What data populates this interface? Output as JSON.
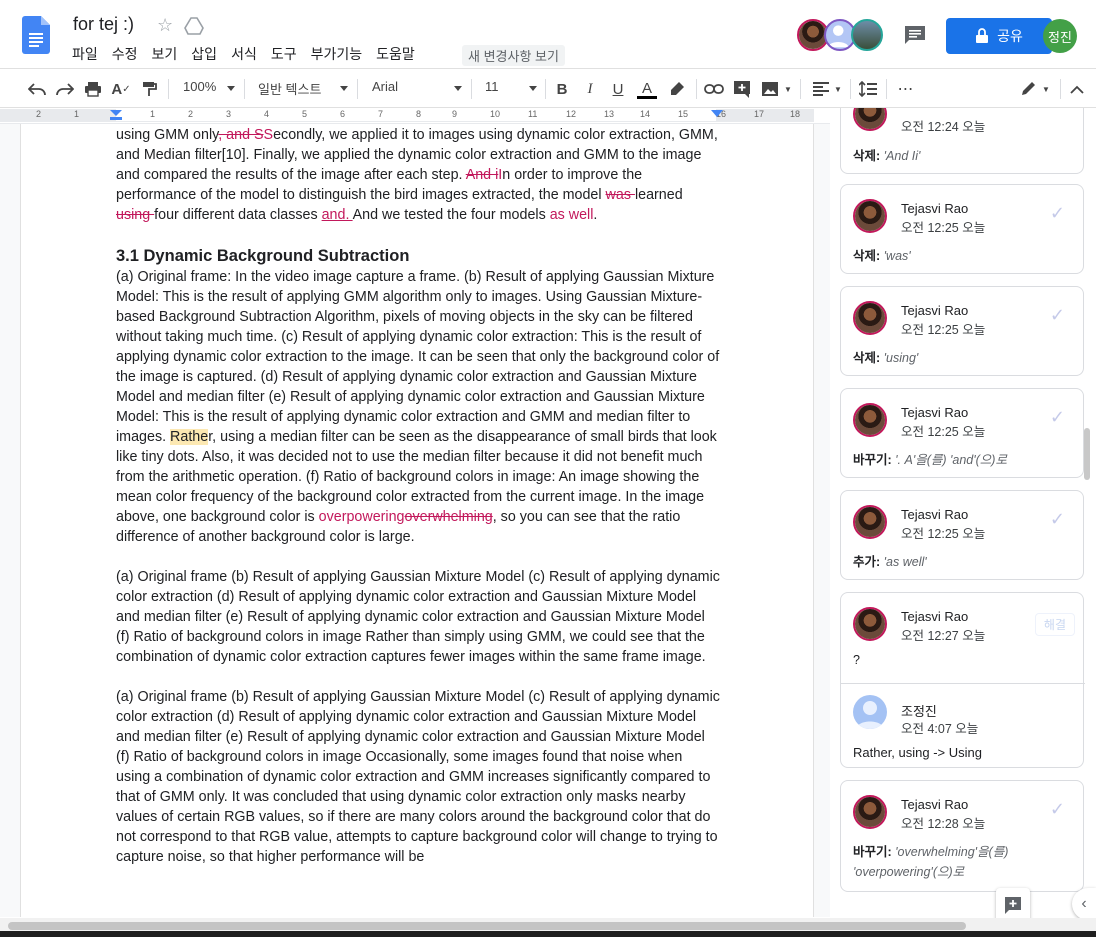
{
  "header": {
    "title": "for tej :)",
    "last_edit": "새 변경사항 보기",
    "share_label": "공유",
    "user_initials": "정진",
    "menu": [
      "파일",
      "수정",
      "보기",
      "삽입",
      "서식",
      "도구",
      "부가기능",
      "도움말"
    ]
  },
  "toolbar": {
    "zoom": "100%",
    "style": "일반 텍스트",
    "font": "Arial",
    "font_size": "11"
  },
  "ruler": {
    "numbers": [
      "2",
      "1",
      "1",
      "2",
      "3",
      "4",
      "5",
      "6",
      "7",
      "8",
      "9",
      "10",
      "11",
      "12",
      "13",
      "14",
      "15",
      "16",
      "17",
      "18"
    ]
  },
  "doc": {
    "p1_a": "using GMM only",
    "p1_del1": ", and S",
    "p1_ins1": "S",
    "p1_b": "econdly, we applied it to images using dynamic color extraction, GMM, and Median filter[10]. Finally, we applied the dynamic color extraction and GMM to the image and compared the results of the image after each step. ",
    "p1_del2": "And i",
    "p1_ins2": "I",
    "p1_c": "n order to improve the performance of the model to distinguish the bird images extracted, the model ",
    "p1_del3": "was ",
    "p1_d": "learned ",
    "p1_del4": "using ",
    "p1_e": "four different data classes ",
    "p1_ins3": "and. ",
    "p1_f": "And we tested the four models",
    "p1_ins4": " as well",
    "p1_g": ".",
    "h1": "3.1 Dynamic Background Subtraction",
    "p2_a": "(a) Original frame: In the video image capture a frame. (b) Result of applying Gaussian Mixture Model: This is the result of applying GMM algorithm only to images. Using Gaussian Mixture-based Background Subtraction Algorithm, pixels of moving objects in the sky can be filtered without taking much time. (c) Result of applying dynamic color extraction: This is the result of applying dynamic color extraction to the image. It can be seen that only the background color of the image is captured. (d) Result of applying dynamic color extraction and Gaussian Mixture Model and median filter (e) Result of applying dynamic color extraction and Gaussian Mixture Model: This is the result of applying dynamic color extraction and GMM and median filter to images. ",
    "p2_hl": "Rathe",
    "p2_b": "r, using a median filter can be seen as the disappearance of small birds that look like tiny dots. Also, it was decided not to use the median filter because it did not benefit much from the arithmetic operation. (f) Ratio of background colors in image: An image showing the mean color frequency of the background color extracted from the current image. In the image above, one background color is ",
    "p2_ins": "overpowering",
    "p2_del": "overwhelming",
    "p2_c": ", so you can see that the ratio difference of another background color is large.",
    "p3": "(a) Original frame (b) Result of applying Gaussian Mixture Model (c) Result of applying dynamic color extraction (d) Result of applying dynamic color extraction and Gaussian Mixture Model and median filter (e) Result of applying dynamic color extraction and Gaussian Mixture Model (f) Ratio of background colors in image Rather than simply using GMM, we could see that the combination of dynamic color extraction captures fewer images within the same frame image.",
    "p4": "(a) Original frame (b) Result of applying Gaussian Mixture Model (c) Result of applying dynamic color extraction (d) Result of applying dynamic color extraction and Gaussian Mixture Model and median filter (e) Result of applying dynamic color extraction and Gaussian Mixture Model (f) Ratio of background colors in image Occasionally, some images found that noise when using a combination of dynamic color extraction and GMM increases significantly compared to that of GMM only. It was concluded that using dynamic color extraction only masks nearby values of certain RGB values, so if there are many colors around the background color that do not correspond to that RGB value, attempts to capture background color will change to trying to capture noise, so that higher performance will be"
  },
  "comments": [
    {
      "time": "오전 12:24 오늘",
      "label": "삭제:",
      "value": "'And Ii'"
    },
    {
      "name": "Tejasvi Rao",
      "time": "오전 12:25 오늘",
      "label": "삭제:",
      "value": "'was'"
    },
    {
      "name": "Tejasvi Rao",
      "time": "오전 12:25 오늘",
      "label": "삭제:",
      "value": "'using'"
    },
    {
      "name": "Tejasvi Rao",
      "time": "오전 12:25 오늘",
      "label": "바꾸기:",
      "value": "'. A'을(를) 'and'(으)로"
    },
    {
      "name": "Tejasvi Rao",
      "time": "오전 12:25 오늘",
      "label": "추가:",
      "value": "'as well'"
    },
    {
      "name": "Tejasvi Rao",
      "time": "오전 12:27 오늘",
      "value": "?",
      "resolve": "해결",
      "reply": {
        "name": "조정진",
        "time": "오전 4:07 오늘",
        "value": "Rather, using -> Using"
      }
    },
    {
      "name": "Tejasvi Rao",
      "time": "오전 12:28 오늘",
      "label": "바꾸기:",
      "value": "'overwhelming'을(를)",
      "value2": "'overpowering'(으)로"
    }
  ]
}
